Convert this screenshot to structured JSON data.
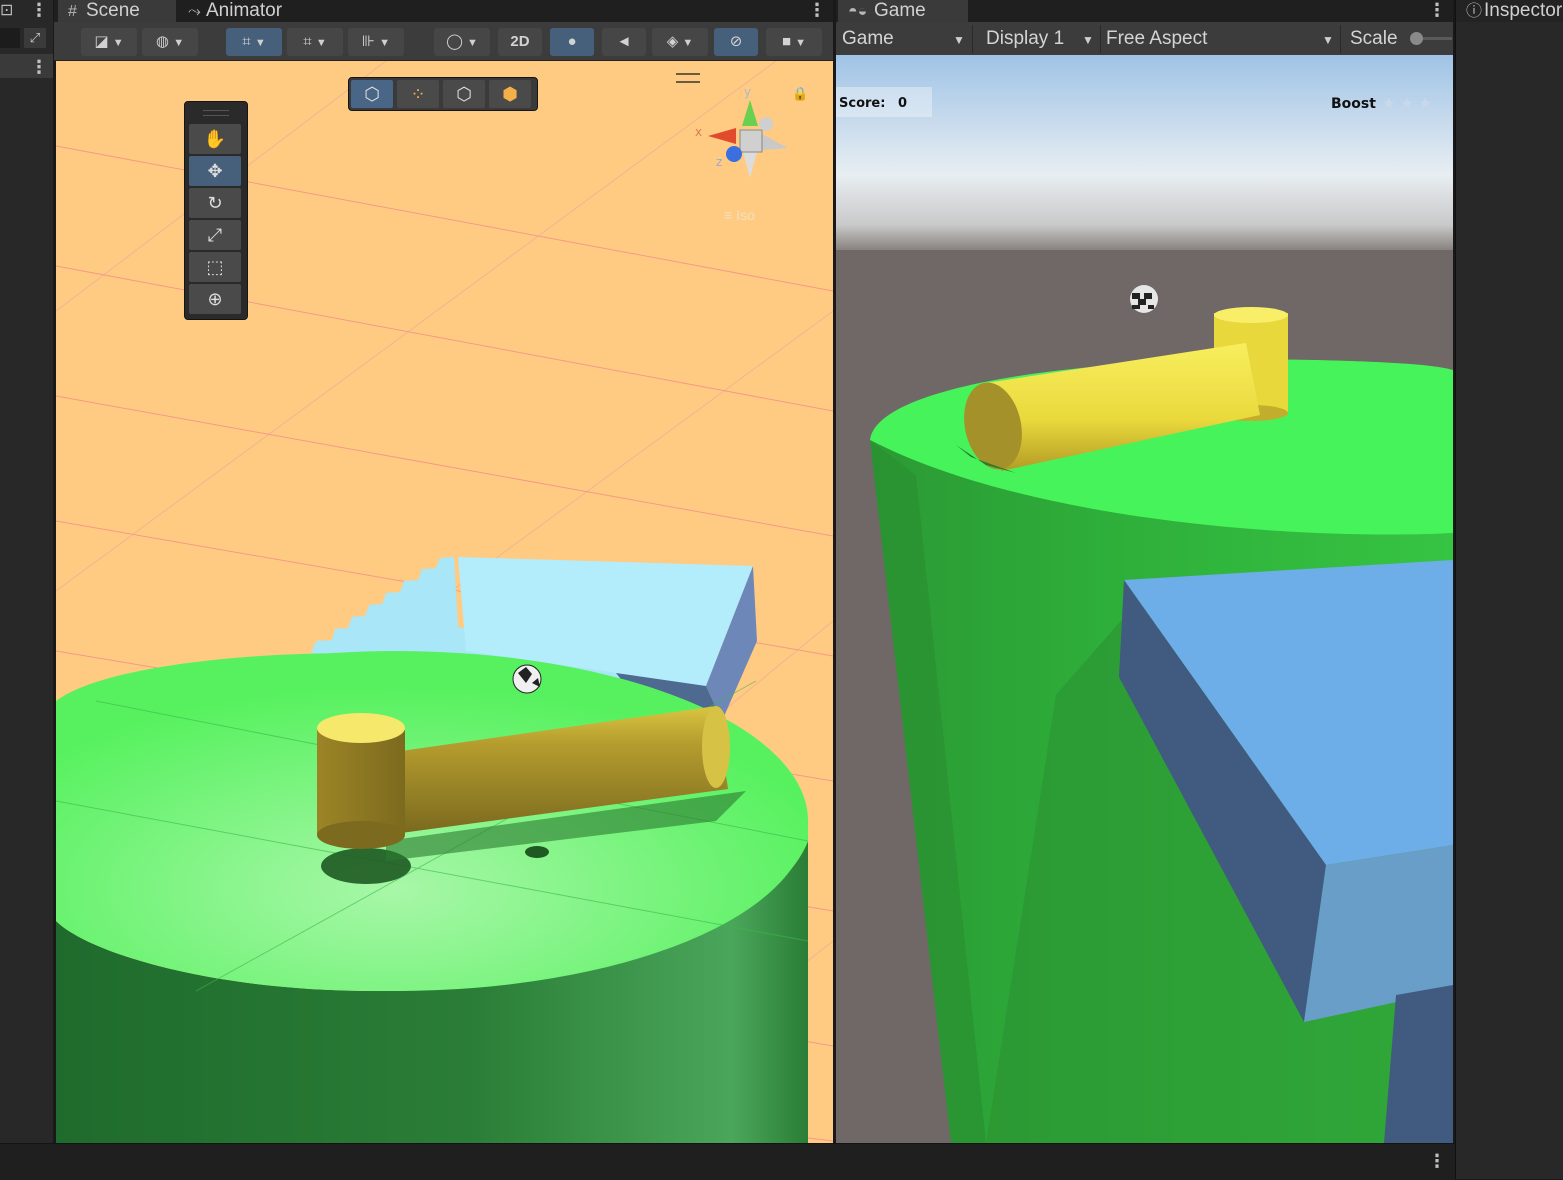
{
  "scene_tabs": {
    "scene_label": "Scene",
    "animator_label": "Animator"
  },
  "scene_toolbar": {
    "mode_2d_label": "2D"
  },
  "gizmo_axes": {
    "x": "x",
    "y": "y",
    "z": "z",
    "persp_label": "Iso"
  },
  "game_tab": {
    "label": "Game"
  },
  "game_toolbar": {
    "mode_label": "Game",
    "display_label": "Display 1",
    "aspect_label": "Free Aspect",
    "scale_label": "Scale"
  },
  "game_hud": {
    "score_label": "Score:",
    "score_value": "0",
    "boost_label": "Boost",
    "boost_stars": "★ ★ ★"
  },
  "inspector_tab": {
    "label": "Inspector"
  },
  "colors": {
    "scene_background": "#ffcb82",
    "ground_green": "#4cf55e",
    "hammer_yellow": "#f2e14e",
    "ramp_blue": "#a9e6f7",
    "active_tool_blue": "#46607c"
  }
}
